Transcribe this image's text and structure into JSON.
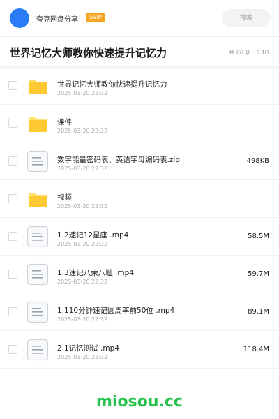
{
  "header": {
    "username": "夸克网盘分享",
    "badge": "SVIP",
    "search_placeholder": "搜索",
    "avatar_color": "#2a7bf6",
    "badge_color": "#f5a623"
  },
  "folder": {
    "title": "世界记忆大师教你快速提升记忆力",
    "summary": "共 66 项 · 5.1G"
  },
  "files": [
    {
      "type": "folder",
      "name": "世界记忆大师教你快速提升记忆力",
      "date": "2025-03-20 22:32",
      "size": ""
    },
    {
      "type": "folder",
      "name": "课件",
      "date": "2025-03-20 22:32",
      "size": ""
    },
    {
      "type": "file",
      "name": "数字能量密码表、英语字母编码表.zip",
      "date": "2025-03-20 22:32",
      "size": "498KB"
    },
    {
      "type": "folder",
      "name": "视频",
      "date": "2025-03-20 22:32",
      "size": ""
    },
    {
      "type": "file",
      "name": "1.2速记12星座  .mp4",
      "date": "2025-03-20 22:32",
      "size": "58.5M"
    },
    {
      "type": "file",
      "name": "1.3速记八荣八耻  .mp4",
      "date": "2025-03-20 22:32",
      "size": "59.7M"
    },
    {
      "type": "file",
      "name": "1.110分钟速记圆周率前50位  .mp4",
      "date": "2025-03-20 22:32",
      "size": "89.1M"
    },
    {
      "type": "file",
      "name": "2.1记忆测试  .mp4",
      "date": "2025-03-20 22:32",
      "size": "118.4M"
    }
  ],
  "watermark": "miosou.cc",
  "colors": {
    "folder_icon": "#ffc933",
    "folder_tab": "#ffdf6e",
    "file_icon_border": "#d0d4da",
    "watermark": "#27c24c"
  }
}
